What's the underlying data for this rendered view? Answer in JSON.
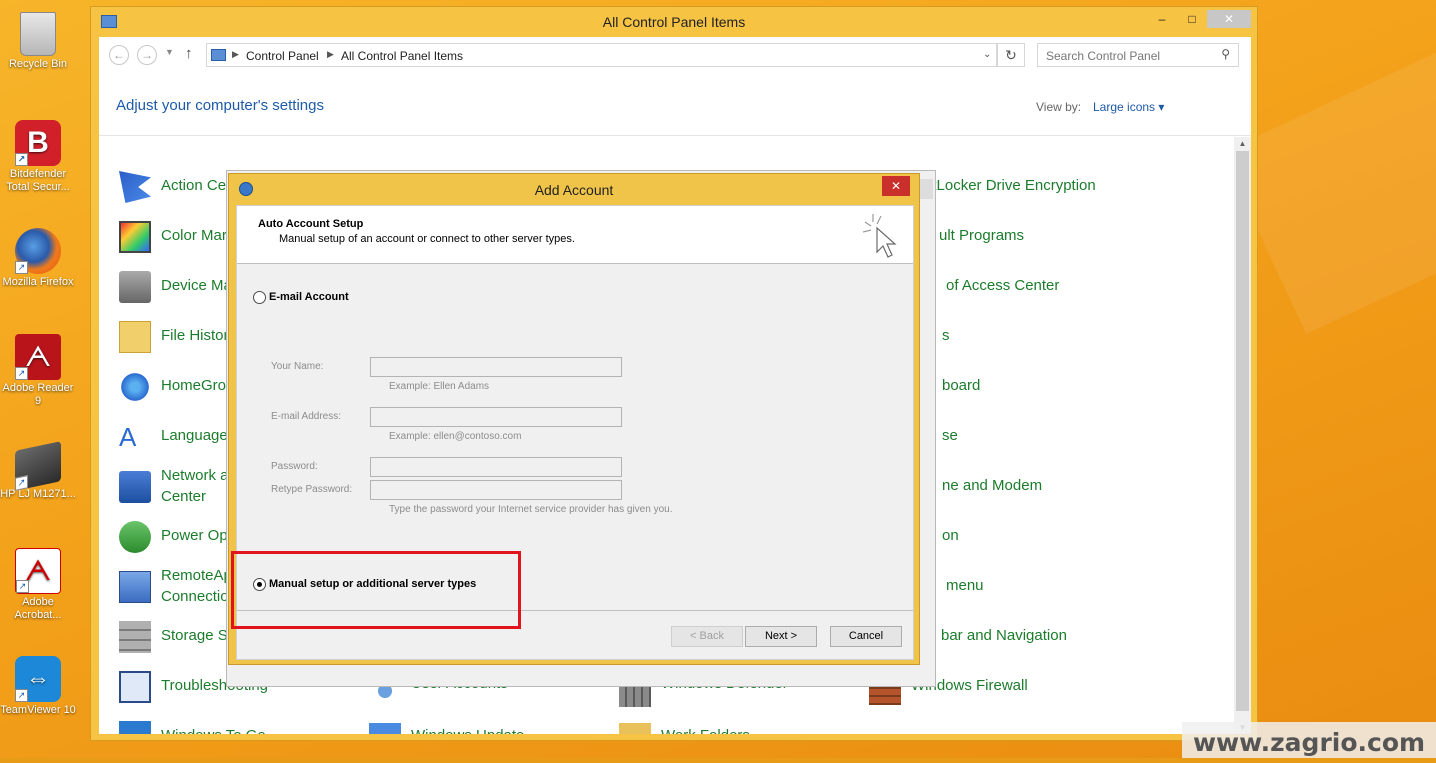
{
  "desktop": {
    "icons": [
      {
        "label": "Recycle Bin",
        "icon": "recycle-bin-icon"
      },
      {
        "label": "Bitdefender Total Secur...",
        "icon": "bitdefender-icon"
      },
      {
        "label": "Mozilla Firefox",
        "icon": "firefox-icon"
      },
      {
        "label": "Adobe Reader 9",
        "icon": "adobe-reader-icon"
      },
      {
        "label": "HP LJ M1271...",
        "icon": "scanner-icon"
      },
      {
        "label": "Adobe Acrobat...",
        "icon": "adobe-acrobat-icon"
      },
      {
        "label": "TeamViewer 10",
        "icon": "teamviewer-icon"
      }
    ]
  },
  "window": {
    "title": "All Control Panel Items",
    "controls": {
      "minimize": "–",
      "maximize": "□",
      "close": "✕"
    }
  },
  "address": {
    "crumb1": "Control Panel",
    "crumb2": "All Control Panel Items",
    "search_placeholder": "Search Control Panel"
  },
  "content": {
    "heading": "Adjust your computer's settings",
    "viewby_label": "View by:",
    "viewby_value": "Large icons ▾",
    "items": [
      "Action Ce",
      "Color Mar",
      "Device Ma",
      "File Histor",
      "HomeGro",
      "Language",
      "Network a Center",
      "Power Op",
      "RemoteAp Connectio",
      "Storage S",
      "Troubleshooting",
      "Windows To Go",
      "User Accounts",
      "Windows Update",
      "Windows Defender",
      "Work Folders",
      "BitLocker Drive Encryption",
      "ult Programs",
      "of Access Center",
      "s",
      "board",
      "se",
      "ne and Modem",
      "on",
      "menu",
      "bar and Navigation",
      "Windows Firewall"
    ]
  },
  "dialog": {
    "title": "Add Account",
    "header_title": "Auto Account Setup",
    "header_sub": "Manual setup of an account or connect to other server types.",
    "option_email": "E-mail Account",
    "name_label": "Your Name:",
    "name_hint": "Example: Ellen Adams",
    "email_label": "E-mail Address:",
    "email_hint": "Example: ellen@contoso.com",
    "password_label": "Password:",
    "retype_label": "Retype Password:",
    "password_hint": "Type the password your Internet service provider has given you.",
    "option_manual": "Manual setup or additional server types",
    "selected_option": "manual",
    "btn_back": "< Back",
    "btn_next": "Next >",
    "btn_cancel": "Cancel"
  },
  "watermark": "www.zagrio.com",
  "colors": {
    "accent_link": "#1e5aa8",
    "item_green": "#1c7c2c",
    "highlight_red": "#e1131c",
    "window_frame": "#f6c343"
  }
}
